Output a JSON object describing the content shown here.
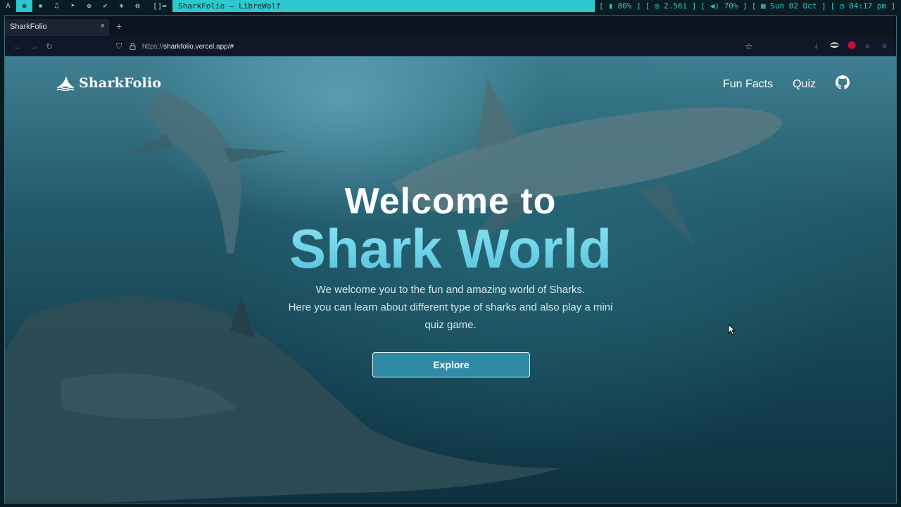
{
  "system_bar": {
    "workspaces": [
      "A",
      "◉",
      "▪",
      "♫",
      "➤",
      "✿",
      "✔",
      "❖",
      "◍"
    ],
    "layout": "[]=",
    "window_title": "SharkFolio — LibreWolf",
    "battery": "[ ▮ 80% ]",
    "disk": "[ ◎ 2.56i ]",
    "volume": "[ ◀) 70% ]",
    "date": "[ ▦ Sun 02 Oct ]",
    "time": "[ ◷ 04:17 pm ]"
  },
  "browser": {
    "tab_title": "SharkFolio",
    "tab_close": "×",
    "new_tab": "+",
    "url_prefix": "https://",
    "url_host": "sharkfolio.vercel.app/#"
  },
  "site": {
    "brand": "SharkFolio",
    "nav": [
      "Fun Facts",
      "Quiz"
    ],
    "hero_line1": "Welcome to",
    "hero_line2": "Shark World",
    "desc_line1": "We welcome you to the fun and amazing world of Sharks.",
    "desc_line2": "Here you can learn about different type of sharks and also play a mini",
    "desc_line3": "quiz game.",
    "cta": "Explore"
  },
  "colors": {
    "accent": "#2ec8cf",
    "hero_gradient_text": "#6fd3ea",
    "button_bg": "#2f8aa6"
  }
}
